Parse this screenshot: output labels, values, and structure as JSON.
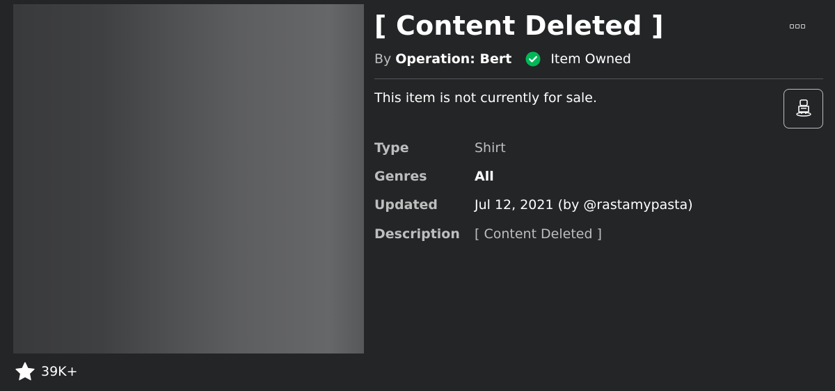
{
  "item": {
    "title": "[ Content Deleted ]",
    "by_label": "By",
    "creator": "Operation: Bert",
    "owned_label": "Item Owned",
    "sale_status": "This item is not currently for sale.",
    "favorites_count": "39K+"
  },
  "details": [
    {
      "label": "Type",
      "value": "Shirt"
    },
    {
      "label": "Genres",
      "value": "All"
    },
    {
      "label": "Updated",
      "value": "Jul 12, 2021 (by @rastamypasta)"
    },
    {
      "label": "Description",
      "value": "[ Content Deleted ]"
    }
  ],
  "icons": {
    "more": "more-options-icon",
    "owned": "check-circle-icon",
    "try_on": "avatar-try-on-icon",
    "favorite": "star-icon"
  },
  "colors": {
    "background": "#232527",
    "owned_check": "#02b757",
    "text_primary": "#ffffff",
    "text_secondary": "#bdbebe"
  }
}
